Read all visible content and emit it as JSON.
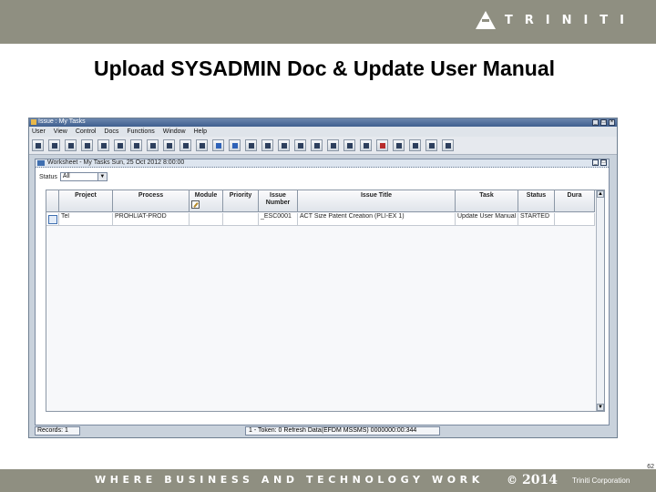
{
  "brand": {
    "name": "TRINITI"
  },
  "slide": {
    "title": "Upload SYSADMIN Doc & Update User Manual",
    "page_number": "62"
  },
  "window": {
    "title": "Issue : My Tasks",
    "controls": [
      "_",
      "□",
      "×"
    ]
  },
  "menu": [
    "User",
    "View",
    "Control",
    "Docs",
    "Functions",
    "Window",
    "Help"
  ],
  "toolbar": {
    "button_count": 26
  },
  "frame": {
    "title": "Worksheet - My Tasks Sun, 25 Oct 2012 8:00:00",
    "controls": [
      "_",
      "□"
    ]
  },
  "filter": {
    "label": "Status",
    "value": "All",
    "arrow": "▼"
  },
  "grid": {
    "columns": [
      {
        "label": "Project",
        "sub": ""
      },
      {
        "label": "Process",
        "sub": ""
      },
      {
        "label": "Module",
        "sub": ""
      },
      {
        "label": "Priority",
        "sub": ""
      },
      {
        "label": "Issue",
        "sub": "Number"
      },
      {
        "label": "Issue Title",
        "sub": ""
      },
      {
        "label": "Task",
        "sub": ""
      },
      {
        "label": "Status",
        "sub": ""
      },
      {
        "label": "Dura",
        "sub": ""
      }
    ],
    "rows": [
      [
        "Tel",
        "PROHLIAT-PROD",
        "",
        "",
        "_ESC0001",
        "ACT Size Patent Creation (PLI-EX 1)",
        "Update User Manual",
        "STARTED",
        ""
      ]
    ]
  },
  "scroll": {
    "up": "▲",
    "down": "▼"
  },
  "status": {
    "records": "Records: 1",
    "connection": "1 - Token: 0 Refresh Data(EFDM MSSMS) 0000000:00:344"
  },
  "footer": {
    "tagline": "WHERE BUSINESS AND TECHNOLOGY WORK",
    "copyright_symbol": "©",
    "year": "2014",
    "corp": "Triniti Corporation"
  }
}
